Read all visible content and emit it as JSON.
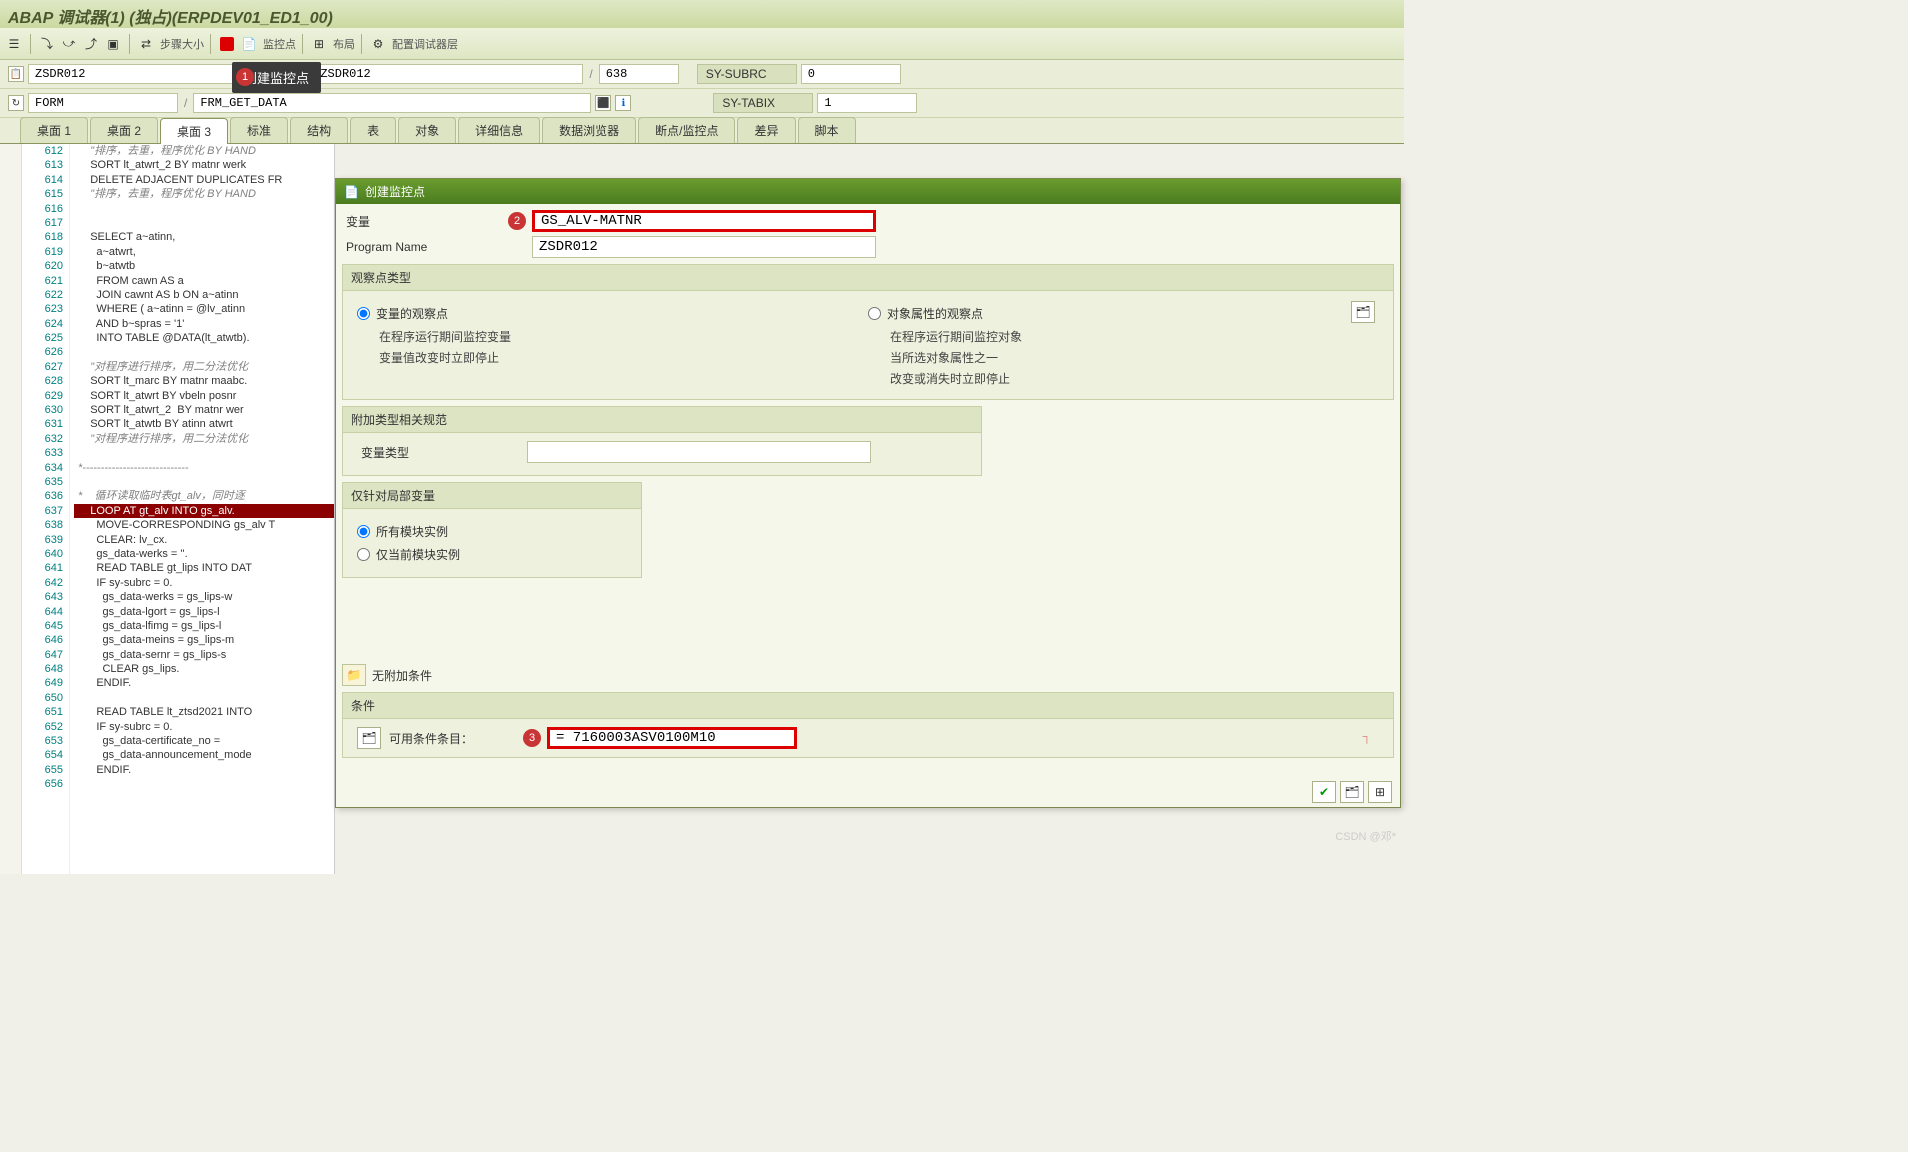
{
  "window": {
    "title": "ABAP 调试器(1) (独占)(ERPDEV01_ED1_00)"
  },
  "toolbar": {
    "step_size": "步骤大小",
    "watchpoint": "监控点",
    "layout": "布局",
    "config_layer": "配置调试器层"
  },
  "tooltip": "创建监控点",
  "badges": {
    "b1": "1",
    "b2": "2",
    "b3": "3"
  },
  "info": {
    "prog1": "ZSDR012",
    "prog2": "ZSDR012",
    "line": "638",
    "subrc_label": "SY-SUBRC",
    "subrc_val": "0",
    "event": "FORM",
    "routine": "FRM_GET_DATA",
    "tabix_label": "SY-TABIX",
    "tabix_val": "1"
  },
  "tabs": [
    "桌面 1",
    "桌面 2",
    "桌面 3",
    "标准",
    "结构",
    "表",
    "对象",
    "详细信息",
    "数据浏览器",
    "断点/监控点",
    "差异",
    "脚本"
  ],
  "active_tab": 2,
  "code_lines": [
    {
      "n": 612,
      "c": "comment",
      "t": "    \"排序，去重，程序优化 BY HAND"
    },
    {
      "n": 613,
      "c": "",
      "t": "    SORT lt_atwrt_2 BY matnr werk"
    },
    {
      "n": 614,
      "c": "",
      "t": "    DELETE ADJACENT DUPLICATES FR"
    },
    {
      "n": 615,
      "c": "comment",
      "t": "    \"排序，去重，程序优化 BY HAND"
    },
    {
      "n": 616,
      "c": "",
      "t": ""
    },
    {
      "n": 617,
      "c": "",
      "t": ""
    },
    {
      "n": 618,
      "c": "",
      "t": "    SELECT a~atinn,"
    },
    {
      "n": 619,
      "c": "",
      "t": "      a~atwrt,"
    },
    {
      "n": 620,
      "c": "",
      "t": "      b~atwtb"
    },
    {
      "n": 621,
      "c": "",
      "t": "      FROM cawn AS a"
    },
    {
      "n": 622,
      "c": "",
      "t": "      JOIN cawnt AS b ON a~atinn "
    },
    {
      "n": 623,
      "c": "",
      "t": "      WHERE ( a~atinn = @lv_atinn"
    },
    {
      "n": 624,
      "c": "",
      "t": "      AND b~spras = '1'"
    },
    {
      "n": 625,
      "c": "",
      "t": "      INTO TABLE @DATA(lt_atwtb)."
    },
    {
      "n": 626,
      "c": "",
      "t": ""
    },
    {
      "n": 627,
      "c": "comment",
      "t": "    \"对程序进行排序，用二分法优化"
    },
    {
      "n": 628,
      "c": "",
      "t": "    SORT lt_marc BY matnr maabc."
    },
    {
      "n": 629,
      "c": "",
      "t": "    SORT lt_atwrt BY vbeln posnr "
    },
    {
      "n": 630,
      "c": "",
      "t": "    SORT lt_atwrt_2  BY matnr wer"
    },
    {
      "n": 631,
      "c": "",
      "t": "    SORT lt_atwtb BY atinn atwrt"
    },
    {
      "n": 632,
      "c": "comment",
      "t": "    \"对程序进行排序，用二分法优化"
    },
    {
      "n": 633,
      "c": "",
      "t": ""
    },
    {
      "n": 634,
      "c": "comment",
      "t": "*-----------------------------"
    },
    {
      "n": 635,
      "c": "",
      "t": ""
    },
    {
      "n": 636,
      "c": "comment",
      "t": "*    循环读取临时表gt_alv，同时逐"
    },
    {
      "n": 637,
      "c": "hl",
      "t": "    LOOP AT gt_alv INTO gs_alv."
    },
    {
      "n": 638,
      "c": "",
      "t": "      MOVE-CORRESPONDING gs_alv T"
    },
    {
      "n": 639,
      "c": "",
      "t": "      CLEAR: lv_cx."
    },
    {
      "n": 640,
      "c": "",
      "t": "      gs_data-werks = ''."
    },
    {
      "n": 641,
      "c": "",
      "t": "      READ TABLE gt_lips INTO DAT"
    },
    {
      "n": 642,
      "c": "",
      "t": "      IF sy-subrc = 0."
    },
    {
      "n": 643,
      "c": "",
      "t": "        gs_data-werks = gs_lips-w"
    },
    {
      "n": 644,
      "c": "",
      "t": "        gs_data-lgort = gs_lips-l"
    },
    {
      "n": 645,
      "c": "",
      "t": "        gs_data-lfimg = gs_lips-l"
    },
    {
      "n": 646,
      "c": "",
      "t": "        gs_data-meins = gs_lips-m"
    },
    {
      "n": 647,
      "c": "",
      "t": "        gs_data-sernr = gs_lips-s"
    },
    {
      "n": 648,
      "c": "",
      "t": "        CLEAR gs_lips."
    },
    {
      "n": 649,
      "c": "",
      "t": "      ENDIF."
    },
    {
      "n": 650,
      "c": "",
      "t": ""
    },
    {
      "n": 651,
      "c": "",
      "t": "      READ TABLE lt_ztsd2021 INTO"
    },
    {
      "n": 652,
      "c": "",
      "t": "      IF sy-subrc = 0."
    },
    {
      "n": 653,
      "c": "",
      "t": "        gs_data-certificate_no = "
    },
    {
      "n": 654,
      "c": "",
      "t": "        gs_data-announcement_mode"
    },
    {
      "n": 655,
      "c": "",
      "t": "      ENDIF."
    },
    {
      "n": 656,
      "c": "",
      "t": ""
    }
  ],
  "dialog": {
    "title": "创建监控点",
    "var_label": "变量",
    "var_value": "GS_ALV-MATNR",
    "prog_label": "Program Name",
    "prog_value": "ZSDR012",
    "watch_type": "观察点类型",
    "radio_var": "变量的观察点",
    "var_desc1": "在程序运行期间监控变量",
    "var_desc2": "变量值改变时立即停止",
    "radio_obj": "对象属性的观察点",
    "obj_desc1": "在程序运行期间监控对象",
    "obj_desc2": "当所选对象属性之一",
    "obj_desc3": "改变或消失时立即停止",
    "addl_type": "附加类型相关规范",
    "var_type_label": "变量类型",
    "local_only": "仅针对局部变量",
    "radio_all": "所有模块实例",
    "radio_cur": "仅当前模块实例",
    "no_cond": "无附加条件",
    "cond_title": "条件",
    "cond_label": "可用条件条目：",
    "cond_value": "= 7160003ASV0100M10"
  },
  "watermark": "CSDN @邓*"
}
